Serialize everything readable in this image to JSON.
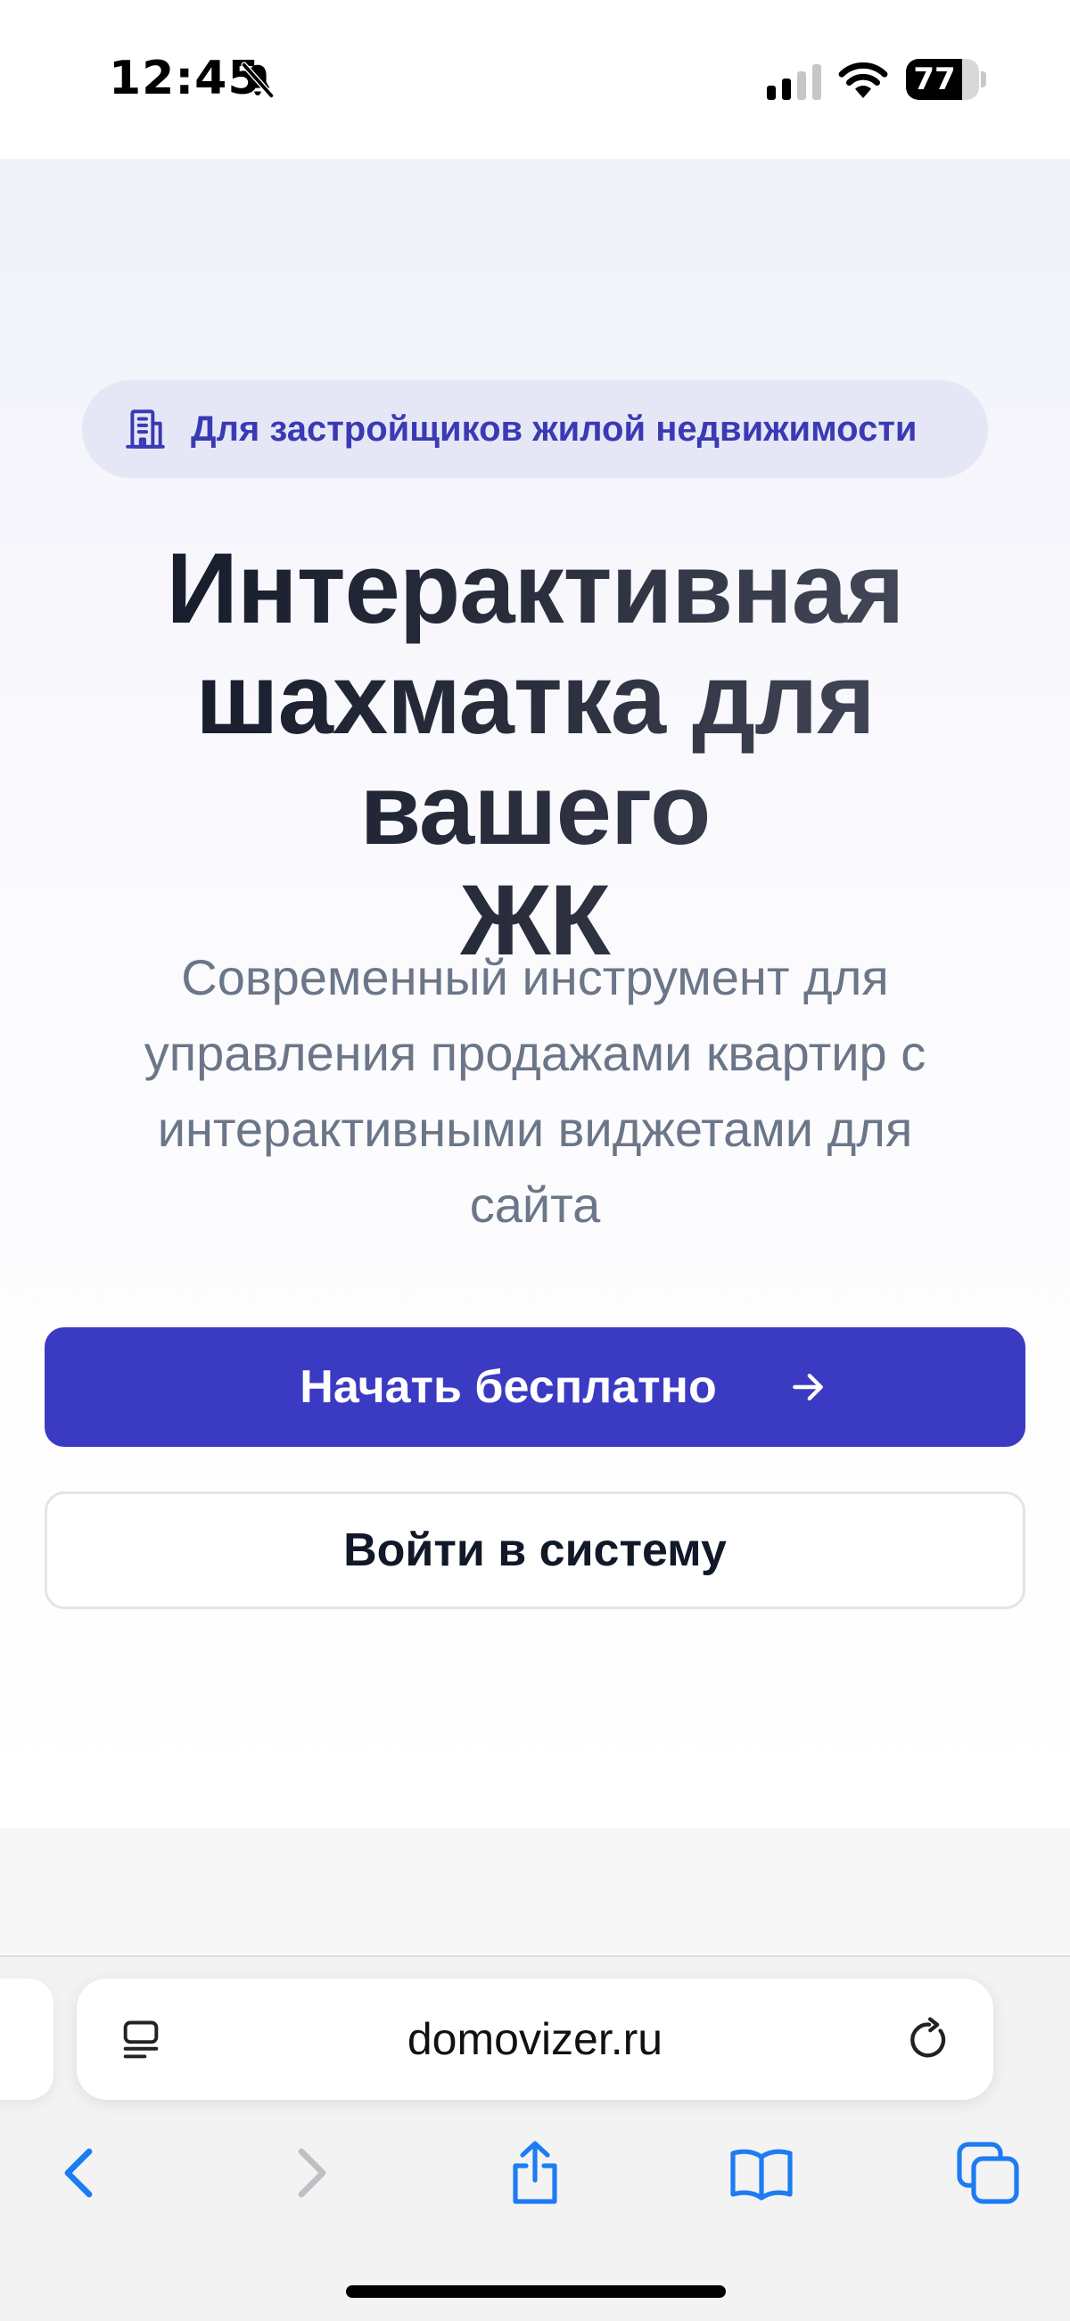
{
  "status_bar": {
    "time": "12:45",
    "battery_level": "77",
    "battery_fraction": 0.77
  },
  "hero": {
    "badge": {
      "icon": "building-icon",
      "label": "Для застройщиков жилой недвижимости"
    },
    "title_lines": [
      "Интерактивная",
      "шахматка для вашего",
      "ЖК"
    ],
    "subtitle_lines": [
      "Современный инструмент для",
      "управления продажами квартир с",
      "интерактивными виджетами для",
      "сайта"
    ],
    "primary_button": {
      "label": "Начать бесплатно",
      "icon": "arrow-right-icon"
    },
    "secondary_button": {
      "label": "Войти в систему"
    }
  },
  "browser": {
    "url": "domovizer.ru",
    "icons": [
      "reader-mode-icon",
      "reload-icon",
      "back-icon",
      "forward-icon",
      "share-icon",
      "bookmarks-icon",
      "tabs-icon"
    ]
  },
  "colors": {
    "brand": "#3A3AC3",
    "badge_background": "#E6E7F6",
    "badge_text": "#3A3AB5",
    "title": "#111727",
    "subtitle": "#6B7688",
    "safari_blue": "#1E7CF2",
    "disabled_gray": "#BFC0C4"
  }
}
